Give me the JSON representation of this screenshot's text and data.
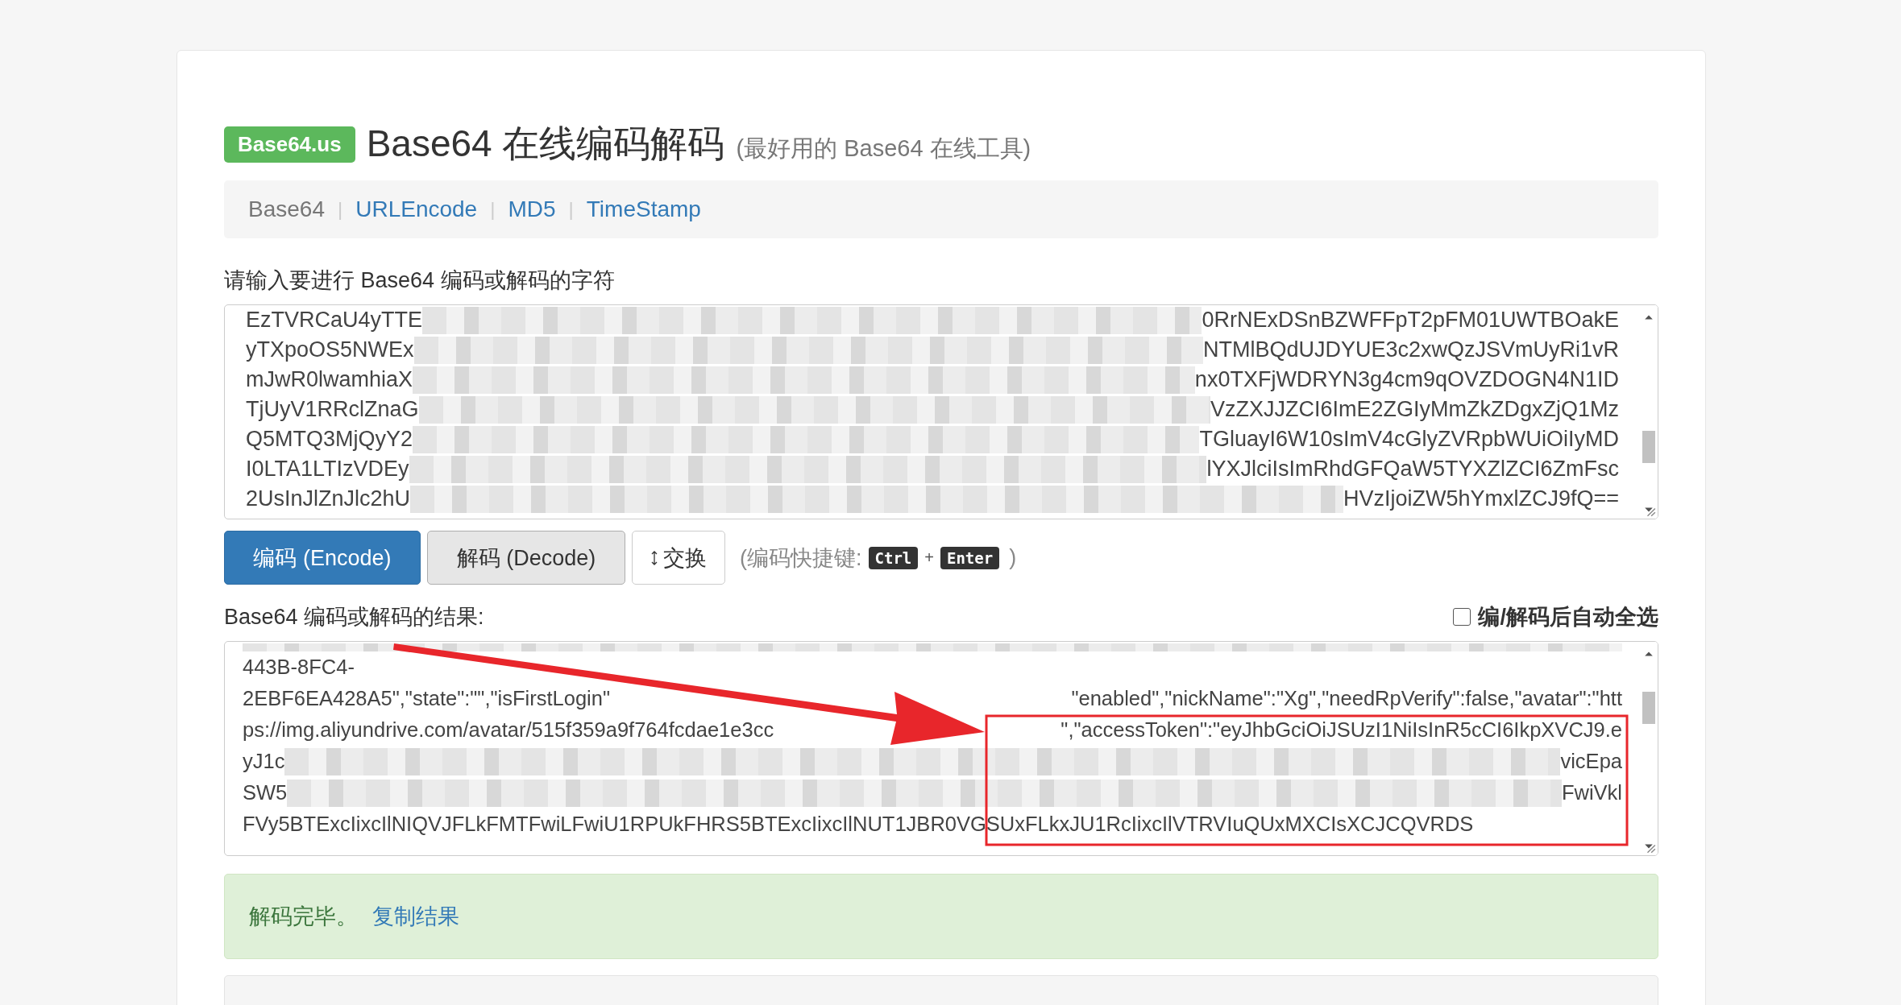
{
  "header": {
    "badge": "Base64.us",
    "title": "Base64 在线编码解码",
    "subtitle": "(最好用的 Base64 在线工具)"
  },
  "nav": {
    "separator": "|",
    "items": [
      {
        "label": "Base64",
        "selected": true
      },
      {
        "label": "URLEncode",
        "selected": false
      },
      {
        "label": "MD5",
        "selected": false
      },
      {
        "label": "TimeStamp",
        "selected": false
      }
    ]
  },
  "input": {
    "label": "请输入要进行 Base64 编码或解码的字符",
    "lines": [
      {
        "left": "EzTVRCaU4yTTE",
        "right": "0RrNExDSnBZWFFpT2pFM01UWTBOakE",
        "kind": "blurred"
      },
      {
        "left": "yTXpoOS5NWEx",
        "right": "NTMlBQdUJDYUE3c2xwQzJSVmUyRi1vR",
        "kind": "blurred"
      },
      {
        "left": "mJwR0lwamhiaX",
        "right": "nx0TXFjWDRYN3g4cm9qOVZDOGN4N1ID",
        "kind": "blurred"
      },
      {
        "left": "TjUyV1RRclZnaG",
        "right": "VzZXJJZCI6ImE2ZGIyMmZkZDgxZjQ1Mz",
        "kind": "blurred"
      },
      {
        "left": "Q5MTQ3MjQyY2",
        "right": "TGluayI6W10sImV4cGlyZVRpbWUiOiIyMD",
        "kind": "blurred"
      },
      {
        "left": "I0LTA1LTIzVDEy",
        "right": "lYXJlciIsImRhdGFQaW5TYXZlZCI6ZmFsc",
        "kind": "blurred"
      },
      {
        "left": "2UsInJlZnJlc2hU",
        "right": "HVzIjoiZW5hYmxlZCJ9fQ==",
        "kind": "blurred"
      }
    ]
  },
  "buttons": [
    {
      "label": "编码 (Encode)",
      "kind": "primary"
    },
    {
      "label": "解码 (Decode)",
      "kind": "default"
    },
    {
      "label": "交换",
      "kind": "swap"
    }
  ],
  "shortcut": {
    "prefix": "(编码快捷键:",
    "keys": [
      "Ctrl",
      "Enter"
    ],
    "plus": "+",
    "suffix": ")"
  },
  "result": {
    "label": "Base64 编码或解码的结果:",
    "auto_select": {
      "label": "编/解码后自动全选",
      "checked": false
    },
    "lines": [
      {
        "left": "443B-8FC4-",
        "kind": "plain"
      },
      {
        "left": "2EBF6EA428A5\",\"state\":\"\",\"isFirstLogin\"",
        "right": "\"enabled\",\"nickName\":\"Xg\",\"needRpVerify\":false,\"avatar\":\"htt",
        "kind": "plain"
      },
      {
        "left": "ps://img.aliyundrive.com/avatar/515f359a9f764fcdae1e3cc",
        "right": "\",\"accessToken\":\"eyJhbGciOiJSUzI1NiIsInR5cCI6IkpXVCJ9.e",
        "kind": "plain"
      },
      {
        "left": "yJ1c",
        "right": "vicEpa",
        "kind": "blurred"
      },
      {
        "left": "SW5",
        "right": "FwiVkl",
        "kind": "blurred"
      },
      {
        "left": "FVy5BTExcIixcIlNIQVJFLkFMTFwiLFwiU1RPUkFHRS5BTExcIixcIlNUT1JBR0VGSUxFLkxJU1RcIixcIlVTRVIuQUxMXCIsXCJCQVRDS",
        "kind": "plain"
      }
    ]
  },
  "status": {
    "message": "解码完毕。",
    "link": "复制结果"
  }
}
